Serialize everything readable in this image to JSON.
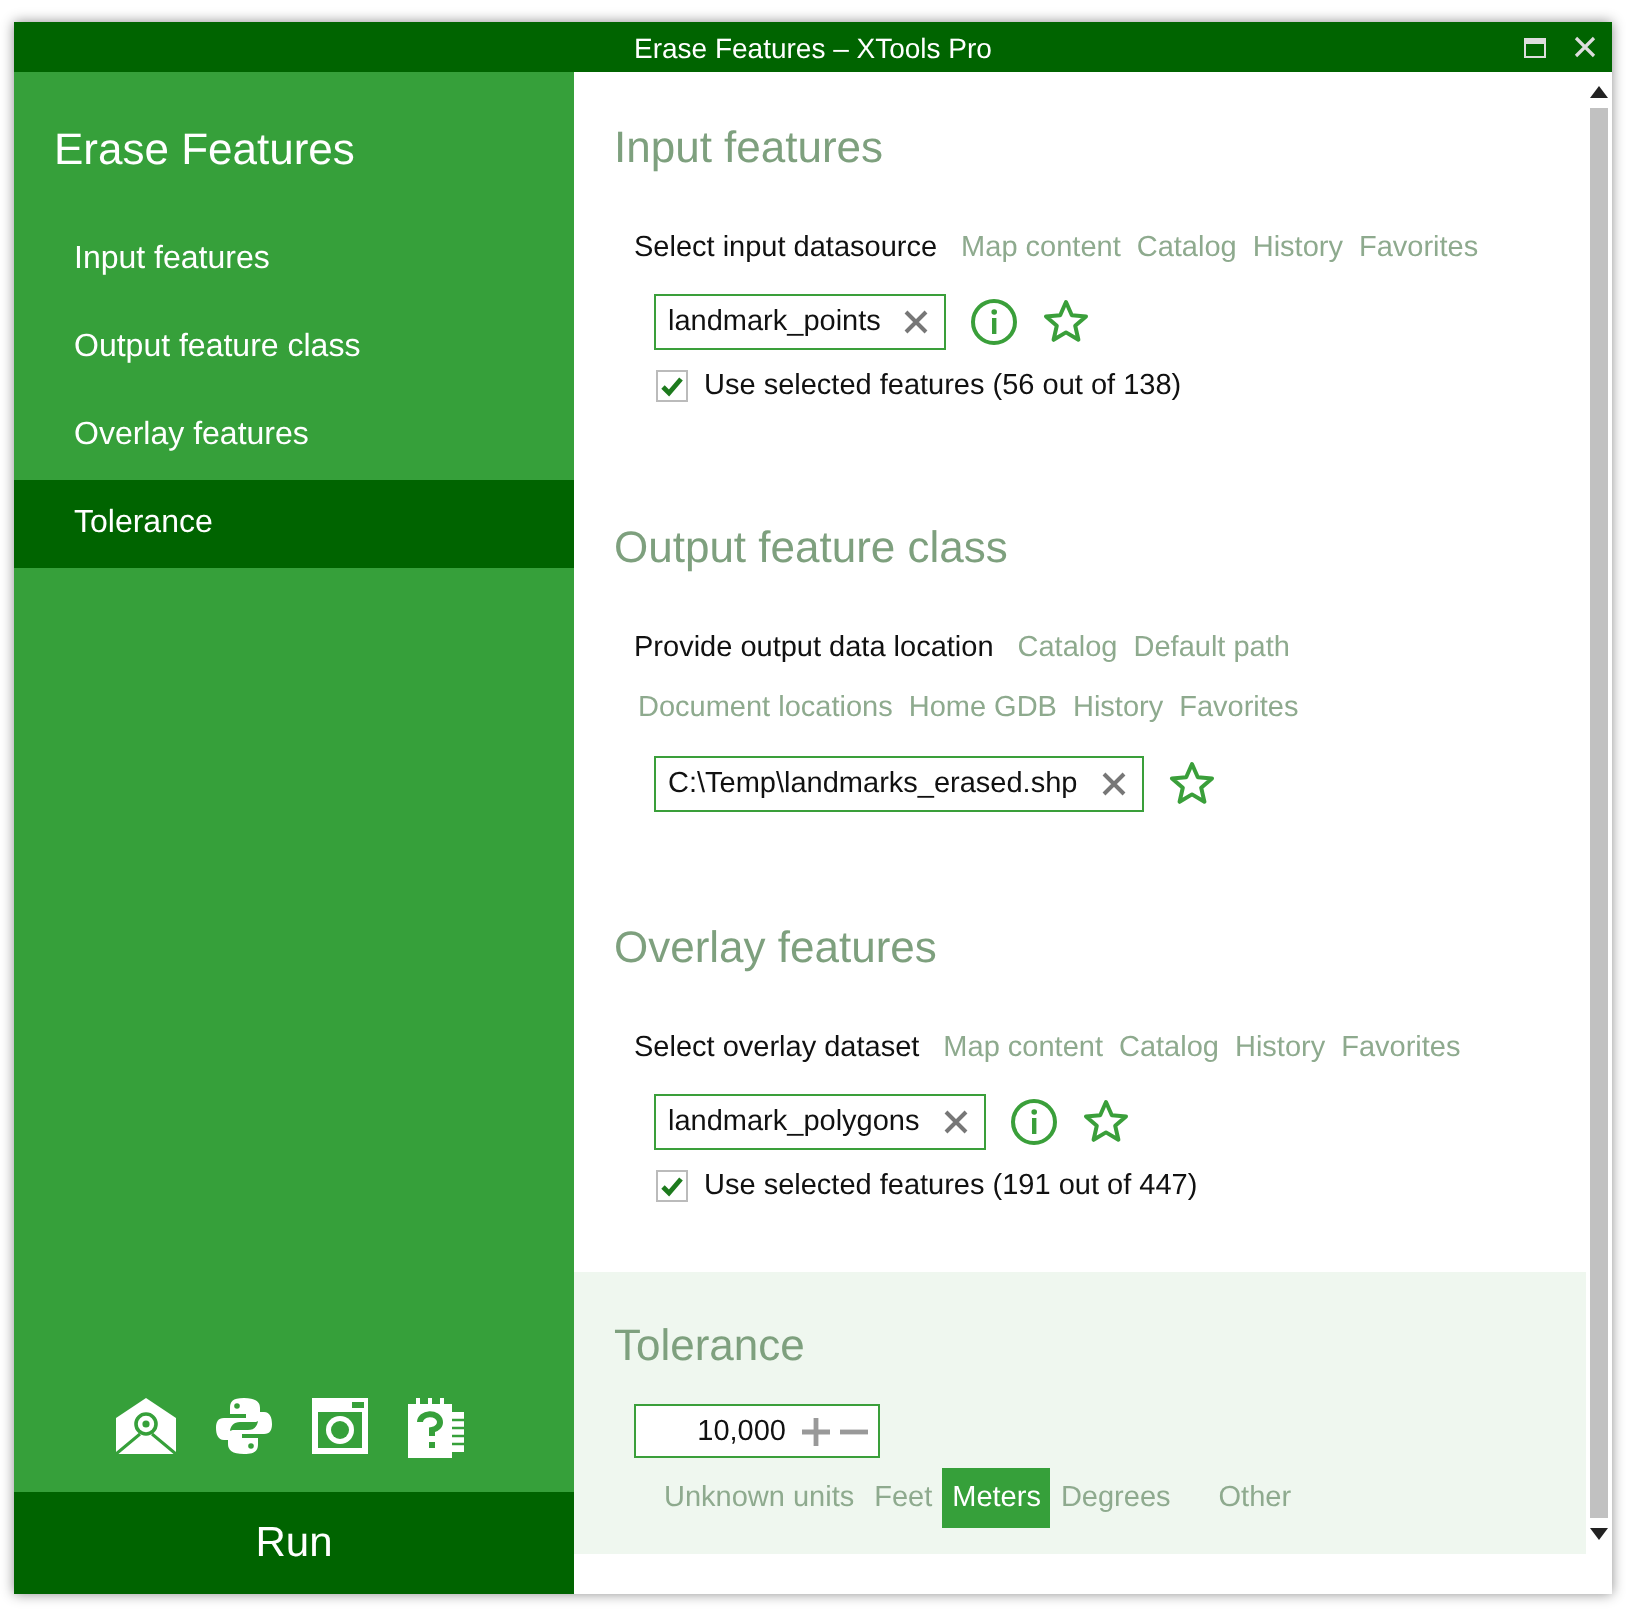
{
  "window": {
    "title": "Erase Features – XTools Pro"
  },
  "sidebar": {
    "title": "Erase Features",
    "items": [
      {
        "label": "Input features",
        "selected": false
      },
      {
        "label": "Output feature class",
        "selected": false
      },
      {
        "label": "Overlay features",
        "selected": false
      },
      {
        "label": "Tolerance",
        "selected": true
      }
    ],
    "run_button": "Run"
  },
  "sections": [
    {
      "kind": "datasource",
      "title": "Input features",
      "highlighted": false,
      "prompt": "Select input datasource",
      "link_rows": [
        [
          "Map content",
          "Catalog",
          "History",
          "Favorites"
        ]
      ],
      "field": {
        "value": "landmark_points",
        "info": true
      },
      "checkbox": {
        "label": "Use selected features (56 out of 138)",
        "checked": true
      }
    },
    {
      "kind": "datasource",
      "title": "Output feature class",
      "highlighted": false,
      "prompt": "Provide output data location",
      "link_rows": [
        [
          "Catalog",
          "Default path"
        ],
        [
          "Document locations",
          "Home GDB",
          "History",
          "Favorites"
        ]
      ],
      "field": {
        "value": "C:\\Temp\\landmarks_erased.shp",
        "info": false
      }
    },
    {
      "kind": "datasource",
      "title": "Overlay features",
      "highlighted": false,
      "prompt": "Select overlay dataset",
      "link_rows": [
        [
          "Map content",
          "Catalog",
          "History",
          "Favorites"
        ]
      ],
      "field": {
        "value": "landmark_polygons",
        "info": true
      },
      "checkbox": {
        "label": "Use selected features (191 out of 447)",
        "checked": true
      }
    },
    {
      "kind": "tolerance",
      "title": "Tolerance",
      "highlighted": true,
      "value": "10,000",
      "units": [
        {
          "label": "Unknown units",
          "selected": false
        },
        {
          "label": "Feet",
          "selected": false
        },
        {
          "label": "Meters",
          "selected": true
        },
        {
          "label": "Degrees",
          "selected": false
        },
        {
          "label": "Other",
          "selected": false
        }
      ]
    }
  ]
}
